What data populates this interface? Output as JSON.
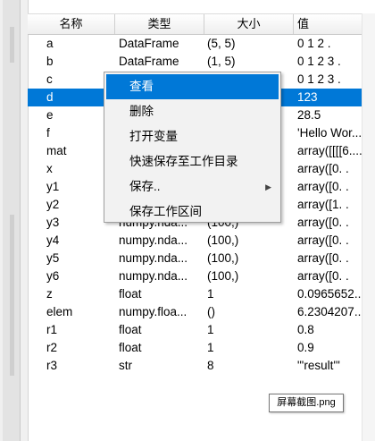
{
  "headers": {
    "name": "名称",
    "type": "类型",
    "size": "大小",
    "value": "值"
  },
  "rows": [
    {
      "name": "a",
      "type": "DataFrame",
      "size": "(5, 5)",
      "value": "  0   1   2    ."
    },
    {
      "name": "b",
      "type": "DataFrame",
      "size": "(1, 5)",
      "value": "  0  1  2  3  ."
    },
    {
      "name": "c",
      "type": "",
      "size": "",
      "value": "  0  1  2  3  ."
    },
    {
      "name": "d",
      "type": "",
      "size": "",
      "value": "123"
    },
    {
      "name": "e",
      "type": "",
      "size": "",
      "value": "28.5"
    },
    {
      "name": "f",
      "type": "",
      "size": "",
      "value": "'Hello Wor..."
    },
    {
      "name": "mat",
      "type": "",
      "size": "",
      "value": "array([[[[6...."
    },
    {
      "name": "x",
      "type": "",
      "size": "",
      "value": "array([0.    ."
    },
    {
      "name": "y1",
      "type": "",
      "size": "",
      "value": "array([0.    ."
    },
    {
      "name": "y2",
      "type": "",
      "size": "",
      "value": "array([1.    ."
    },
    {
      "name": "y3",
      "type": "numpy.nda...",
      "size": "(100,)",
      "value": "array([0.    ."
    },
    {
      "name": "y4",
      "type": "numpy.nda...",
      "size": "(100,)",
      "value": "array([0.    ."
    },
    {
      "name": "y5",
      "type": "numpy.nda...",
      "size": "(100,)",
      "value": "array([0.    ."
    },
    {
      "name": "y6",
      "type": "numpy.nda...",
      "size": "(100,)",
      "value": "array([0.    ."
    },
    {
      "name": "z",
      "type": "float",
      "size": "1",
      "value": "0.0965652..."
    },
    {
      "name": "elem",
      "type": "numpy.floa...",
      "size": "()",
      "value": "6.2304207..."
    },
    {
      "name": "r1",
      "type": "float",
      "size": "1",
      "value": "0.8"
    },
    {
      "name": "r2",
      "type": "float",
      "size": "1",
      "value": "0.9"
    },
    {
      "name": "r3",
      "type": "str",
      "size": "8",
      "value": "\"'result'\""
    }
  ],
  "selected_row": 3,
  "menu": {
    "items": [
      "查看",
      "删除",
      "打开变量",
      "快速保存至工作目录",
      "保存..",
      "保存工作区间"
    ],
    "active_index": 0
  },
  "tooltip": "屏幕截图.png",
  "colors": {
    "selection": "#0078d7",
    "menu_bg": "#f2f2f2"
  }
}
